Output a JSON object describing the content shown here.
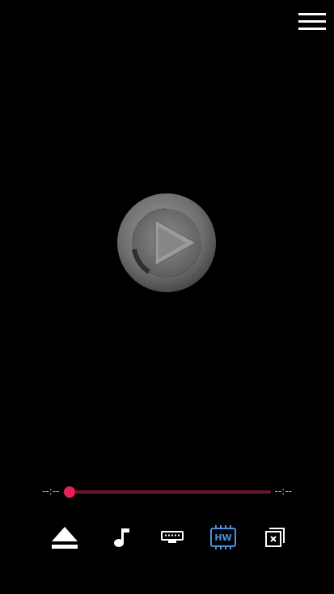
{
  "player": {
    "elapsed_time": "--:--",
    "remaining_time": "--:--",
    "progress_fraction": 0.0,
    "accent_color": "#e8205a",
    "track_color": "#6a1530"
  },
  "controls": {
    "hardware_decoder_label": "HW",
    "hardware_decoder_color": "#4a90e2",
    "icons": [
      "eject-icon",
      "music-note-icon",
      "keyboard-icon",
      "hw-decoder-icon",
      "close-overlay-icon"
    ]
  },
  "header": {
    "menu_icon": "hamburger-menu-icon"
  }
}
